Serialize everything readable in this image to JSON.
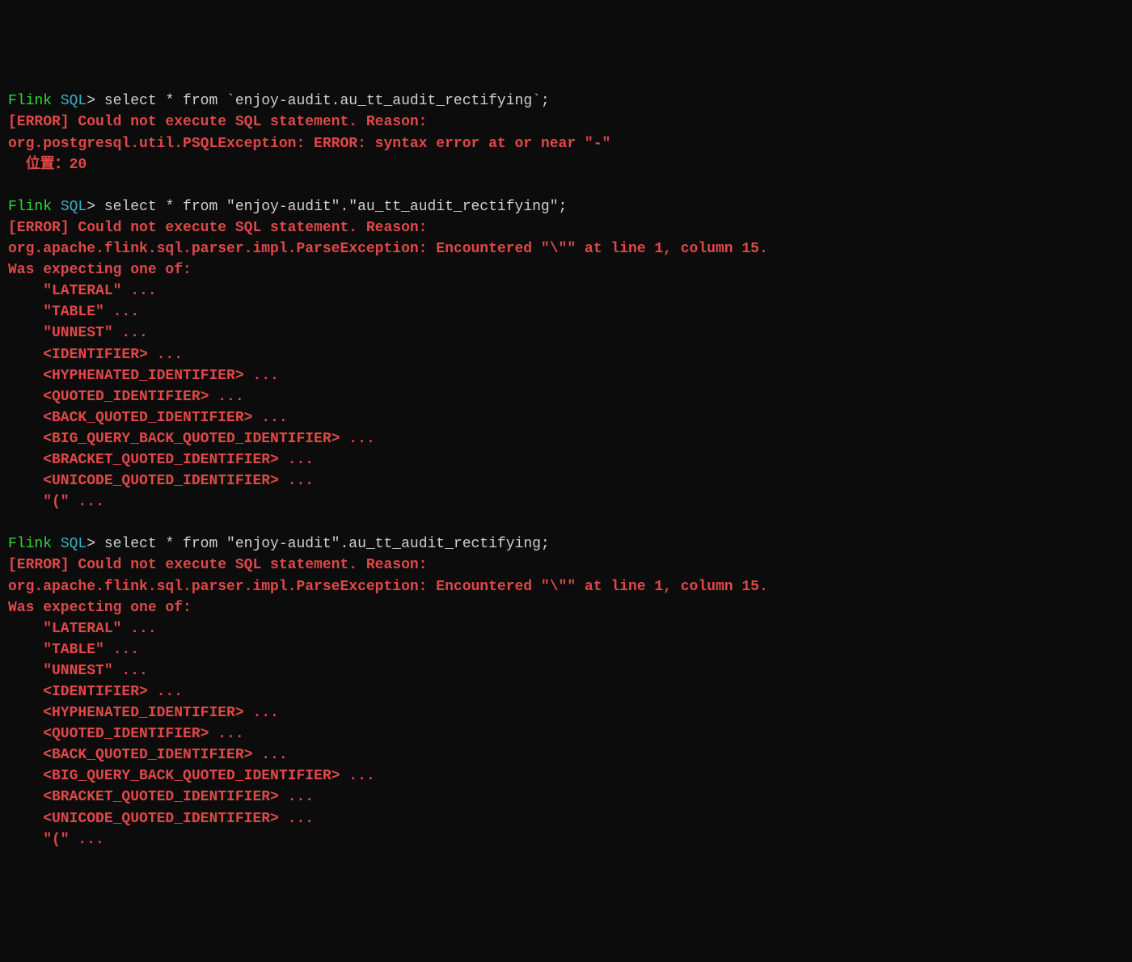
{
  "prompt": {
    "flink": "Flink ",
    "sql": "SQL",
    "caret": "> "
  },
  "blocks": [
    {
      "command": "select * from `enjoy-audit.au_tt_audit_rectifying`;",
      "errorLines": [
        "[ERROR] Could not execute SQL statement. Reason:",
        "org.postgresql.util.PSQLException: ERROR: syntax error at or near \"-\"",
        "  位置：20"
      ]
    },
    {
      "command": "select * from \"enjoy-audit\".\"au_tt_audit_rectifying\";",
      "errorLines": [
        "[ERROR] Could not execute SQL statement. Reason:",
        "org.apache.flink.sql.parser.impl.ParseException: Encountered \"\\\"\" at line 1, column 15.",
        "Was expecting one of:",
        "    \"LATERAL\" ...",
        "    \"TABLE\" ...",
        "    \"UNNEST\" ...",
        "    <IDENTIFIER> ...",
        "    <HYPHENATED_IDENTIFIER> ...",
        "    <QUOTED_IDENTIFIER> ...",
        "    <BACK_QUOTED_IDENTIFIER> ...",
        "    <BIG_QUERY_BACK_QUOTED_IDENTIFIER> ...",
        "    <BRACKET_QUOTED_IDENTIFIER> ...",
        "    <UNICODE_QUOTED_IDENTIFIER> ...",
        "    \"(\" ..."
      ]
    },
    {
      "command": "select * from \"enjoy-audit\".au_tt_audit_rectifying;",
      "errorLines": [
        "[ERROR] Could not execute SQL statement. Reason:",
        "org.apache.flink.sql.parser.impl.ParseException: Encountered \"\\\"\" at line 1, column 15.",
        "Was expecting one of:",
        "    \"LATERAL\" ...",
        "    \"TABLE\" ...",
        "    \"UNNEST\" ...",
        "    <IDENTIFIER> ...",
        "    <HYPHENATED_IDENTIFIER> ...",
        "    <QUOTED_IDENTIFIER> ...",
        "    <BACK_QUOTED_IDENTIFIER> ...",
        "    <BIG_QUERY_BACK_QUOTED_IDENTIFIER> ...",
        "    <BRACKET_QUOTED_IDENTIFIER> ...",
        "    <UNICODE_QUOTED_IDENTIFIER> ...",
        "    \"(\" ..."
      ]
    }
  ]
}
